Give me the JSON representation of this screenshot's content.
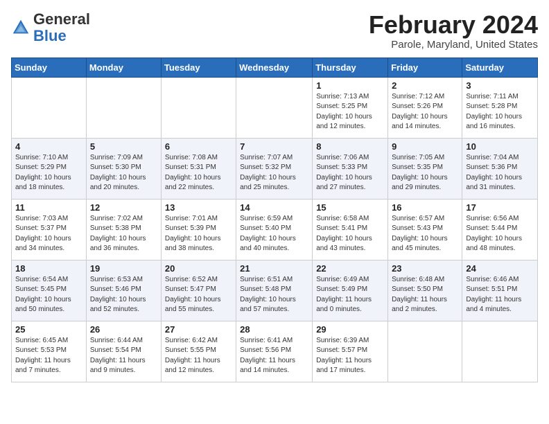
{
  "header": {
    "logo_general": "General",
    "logo_blue": "Blue",
    "month_title": "February 2024",
    "location": "Parole, Maryland, United States"
  },
  "days_of_week": [
    "Sunday",
    "Monday",
    "Tuesday",
    "Wednesday",
    "Thursday",
    "Friday",
    "Saturday"
  ],
  "weeks": [
    [
      {
        "day": "",
        "info": ""
      },
      {
        "day": "",
        "info": ""
      },
      {
        "day": "",
        "info": ""
      },
      {
        "day": "",
        "info": ""
      },
      {
        "day": "1",
        "info": "Sunrise: 7:13 AM\nSunset: 5:25 PM\nDaylight: 10 hours\nand 12 minutes."
      },
      {
        "day": "2",
        "info": "Sunrise: 7:12 AM\nSunset: 5:26 PM\nDaylight: 10 hours\nand 14 minutes."
      },
      {
        "day": "3",
        "info": "Sunrise: 7:11 AM\nSunset: 5:28 PM\nDaylight: 10 hours\nand 16 minutes."
      }
    ],
    [
      {
        "day": "4",
        "info": "Sunrise: 7:10 AM\nSunset: 5:29 PM\nDaylight: 10 hours\nand 18 minutes."
      },
      {
        "day": "5",
        "info": "Sunrise: 7:09 AM\nSunset: 5:30 PM\nDaylight: 10 hours\nand 20 minutes."
      },
      {
        "day": "6",
        "info": "Sunrise: 7:08 AM\nSunset: 5:31 PM\nDaylight: 10 hours\nand 22 minutes."
      },
      {
        "day": "7",
        "info": "Sunrise: 7:07 AM\nSunset: 5:32 PM\nDaylight: 10 hours\nand 25 minutes."
      },
      {
        "day": "8",
        "info": "Sunrise: 7:06 AM\nSunset: 5:33 PM\nDaylight: 10 hours\nand 27 minutes."
      },
      {
        "day": "9",
        "info": "Sunrise: 7:05 AM\nSunset: 5:35 PM\nDaylight: 10 hours\nand 29 minutes."
      },
      {
        "day": "10",
        "info": "Sunrise: 7:04 AM\nSunset: 5:36 PM\nDaylight: 10 hours\nand 31 minutes."
      }
    ],
    [
      {
        "day": "11",
        "info": "Sunrise: 7:03 AM\nSunset: 5:37 PM\nDaylight: 10 hours\nand 34 minutes."
      },
      {
        "day": "12",
        "info": "Sunrise: 7:02 AM\nSunset: 5:38 PM\nDaylight: 10 hours\nand 36 minutes."
      },
      {
        "day": "13",
        "info": "Sunrise: 7:01 AM\nSunset: 5:39 PM\nDaylight: 10 hours\nand 38 minutes."
      },
      {
        "day": "14",
        "info": "Sunrise: 6:59 AM\nSunset: 5:40 PM\nDaylight: 10 hours\nand 40 minutes."
      },
      {
        "day": "15",
        "info": "Sunrise: 6:58 AM\nSunset: 5:41 PM\nDaylight: 10 hours\nand 43 minutes."
      },
      {
        "day": "16",
        "info": "Sunrise: 6:57 AM\nSunset: 5:43 PM\nDaylight: 10 hours\nand 45 minutes."
      },
      {
        "day": "17",
        "info": "Sunrise: 6:56 AM\nSunset: 5:44 PM\nDaylight: 10 hours\nand 48 minutes."
      }
    ],
    [
      {
        "day": "18",
        "info": "Sunrise: 6:54 AM\nSunset: 5:45 PM\nDaylight: 10 hours\nand 50 minutes."
      },
      {
        "day": "19",
        "info": "Sunrise: 6:53 AM\nSunset: 5:46 PM\nDaylight: 10 hours\nand 52 minutes."
      },
      {
        "day": "20",
        "info": "Sunrise: 6:52 AM\nSunset: 5:47 PM\nDaylight: 10 hours\nand 55 minutes."
      },
      {
        "day": "21",
        "info": "Sunrise: 6:51 AM\nSunset: 5:48 PM\nDaylight: 10 hours\nand 57 minutes."
      },
      {
        "day": "22",
        "info": "Sunrise: 6:49 AM\nSunset: 5:49 PM\nDaylight: 11 hours\nand 0 minutes."
      },
      {
        "day": "23",
        "info": "Sunrise: 6:48 AM\nSunset: 5:50 PM\nDaylight: 11 hours\nand 2 minutes."
      },
      {
        "day": "24",
        "info": "Sunrise: 6:46 AM\nSunset: 5:51 PM\nDaylight: 11 hours\nand 4 minutes."
      }
    ],
    [
      {
        "day": "25",
        "info": "Sunrise: 6:45 AM\nSunset: 5:53 PM\nDaylight: 11 hours\nand 7 minutes."
      },
      {
        "day": "26",
        "info": "Sunrise: 6:44 AM\nSunset: 5:54 PM\nDaylight: 11 hours\nand 9 minutes."
      },
      {
        "day": "27",
        "info": "Sunrise: 6:42 AM\nSunset: 5:55 PM\nDaylight: 11 hours\nand 12 minutes."
      },
      {
        "day": "28",
        "info": "Sunrise: 6:41 AM\nSunset: 5:56 PM\nDaylight: 11 hours\nand 14 minutes."
      },
      {
        "day": "29",
        "info": "Sunrise: 6:39 AM\nSunset: 5:57 PM\nDaylight: 11 hours\nand 17 minutes."
      },
      {
        "day": "",
        "info": ""
      },
      {
        "day": "",
        "info": ""
      }
    ]
  ]
}
